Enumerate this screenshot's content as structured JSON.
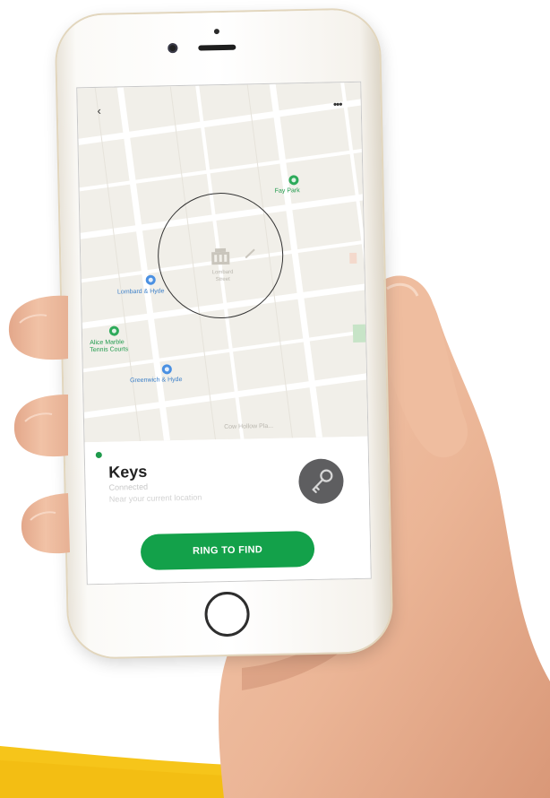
{
  "colors": {
    "accent_green": "#13a14a",
    "swoosh_yellow": "#f6c51a",
    "map_background": "#f1efe9",
    "avatar_gray": "#5e5e60"
  },
  "top_bar": {
    "back_icon": "chevron-left-icon",
    "more_icon": "more-horizontal-icon",
    "back_glyph": "‹",
    "more_glyph": "•••"
  },
  "map": {
    "places": [
      {
        "label": "Fay Park",
        "kind": "park"
      },
      {
        "label": "Lombard & Hyde",
        "kind": "transit"
      },
      {
        "label": "Alice Marble Tennis Courts",
        "kind": "park"
      },
      {
        "label": "Greenwich & Hyde",
        "kind": "transit"
      }
    ],
    "center_label": "Lombard Street",
    "bottom_label": "Cow Hollow Pla..."
  },
  "device": {
    "name": "Keys",
    "status": "Connected",
    "address": "Near your current location",
    "icon": "key-icon",
    "connected": true
  },
  "actions": {
    "ring_label": "RING TO FIND"
  }
}
